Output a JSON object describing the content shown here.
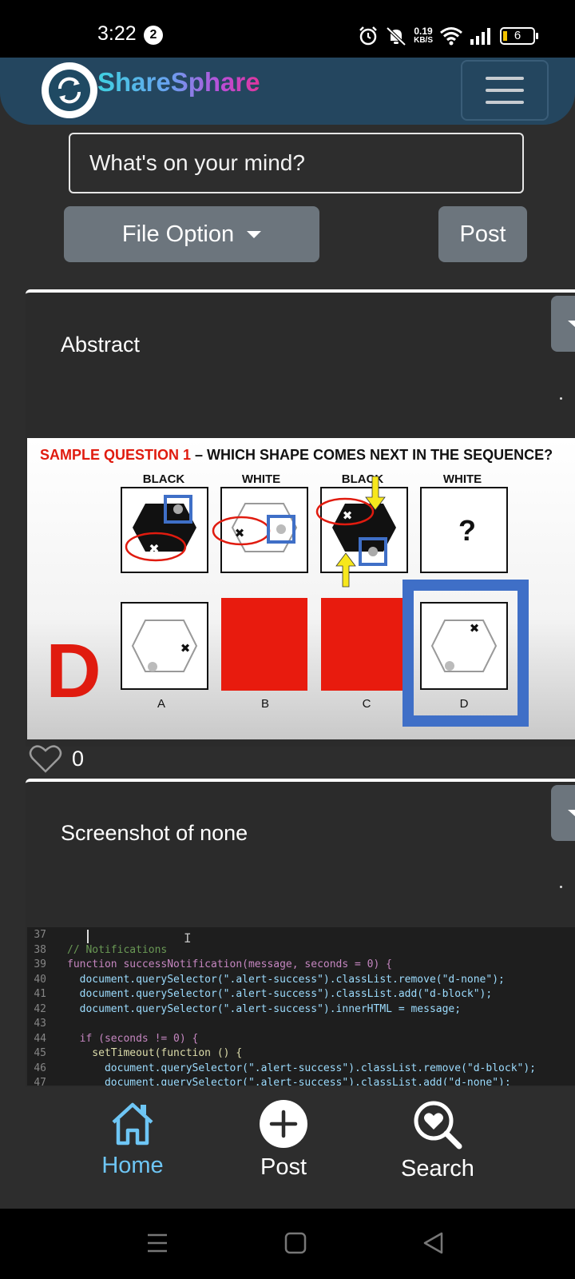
{
  "status_bar": {
    "time": "3:22",
    "notification_count": "2",
    "net_speed_value": "0.19",
    "net_speed_unit": "KB/S",
    "battery_level": "6"
  },
  "app": {
    "brand": "ShareSphare"
  },
  "composer": {
    "placeholder": "What's on your mind?",
    "file_option_label": "File Option",
    "post_label": "Post"
  },
  "posts": [
    {
      "title": "Abstract",
      "like_count": "0",
      "image": {
        "kind": "abstract-reasoning-question",
        "heading_red": "SAMPLE QUESTION 1",
        "heading_dash": " – ",
        "heading_black": "WHICH SHAPE COMES NEXT IN THE SEQUENCE?",
        "column_labels": [
          "BLACK",
          "WHITE",
          "BLACK",
          "WHITE"
        ],
        "question_mark": "?",
        "answer_letter": "D",
        "option_labels": [
          "A",
          "B",
          "C",
          "D"
        ]
      }
    },
    {
      "title": "Screenshot of none",
      "image": {
        "kind": "code-screenshot",
        "lines": [
          {
            "n": "37",
            "code": ""
          },
          {
            "n": "38",
            "code": "// Notifications"
          },
          {
            "n": "39",
            "code": "function successNotification(message, seconds = 0) {"
          },
          {
            "n": "40",
            "code": "  document.querySelector(\".alert-success\").classList.remove(\"d-none\");"
          },
          {
            "n": "41",
            "code": "  document.querySelector(\".alert-success\").classList.add(\"d-block\");"
          },
          {
            "n": "42",
            "code": "  document.querySelector(\".alert-success\").innerHTML = message;"
          },
          {
            "n": "43",
            "code": ""
          },
          {
            "n": "44",
            "code": "  if (seconds != 0) {"
          },
          {
            "n": "45",
            "code": "    setTimeout(function () {"
          },
          {
            "n": "46",
            "code": "      document.querySelector(\".alert-success\").classList.remove(\"d-block\");"
          },
          {
            "n": "47",
            "code": "      document.querySelector(\".alert-success\").classList.add(\"d-none\");"
          }
        ]
      }
    }
  ],
  "bottom_nav": {
    "items": [
      {
        "label": "Home",
        "icon": "home-icon",
        "active": true
      },
      {
        "label": "Post",
        "icon": "plus-circle-icon",
        "active": false
      },
      {
        "label": "Search",
        "icon": "heart-search-icon",
        "active": false
      }
    ]
  },
  "colors": {
    "background": "#2d2d2d",
    "header": "#24465f",
    "button_gray": "#6c757d",
    "active_nav": "#6ec6f5",
    "answer_red": "#e01b0f",
    "highlight_blue": "#3f6fc7"
  }
}
